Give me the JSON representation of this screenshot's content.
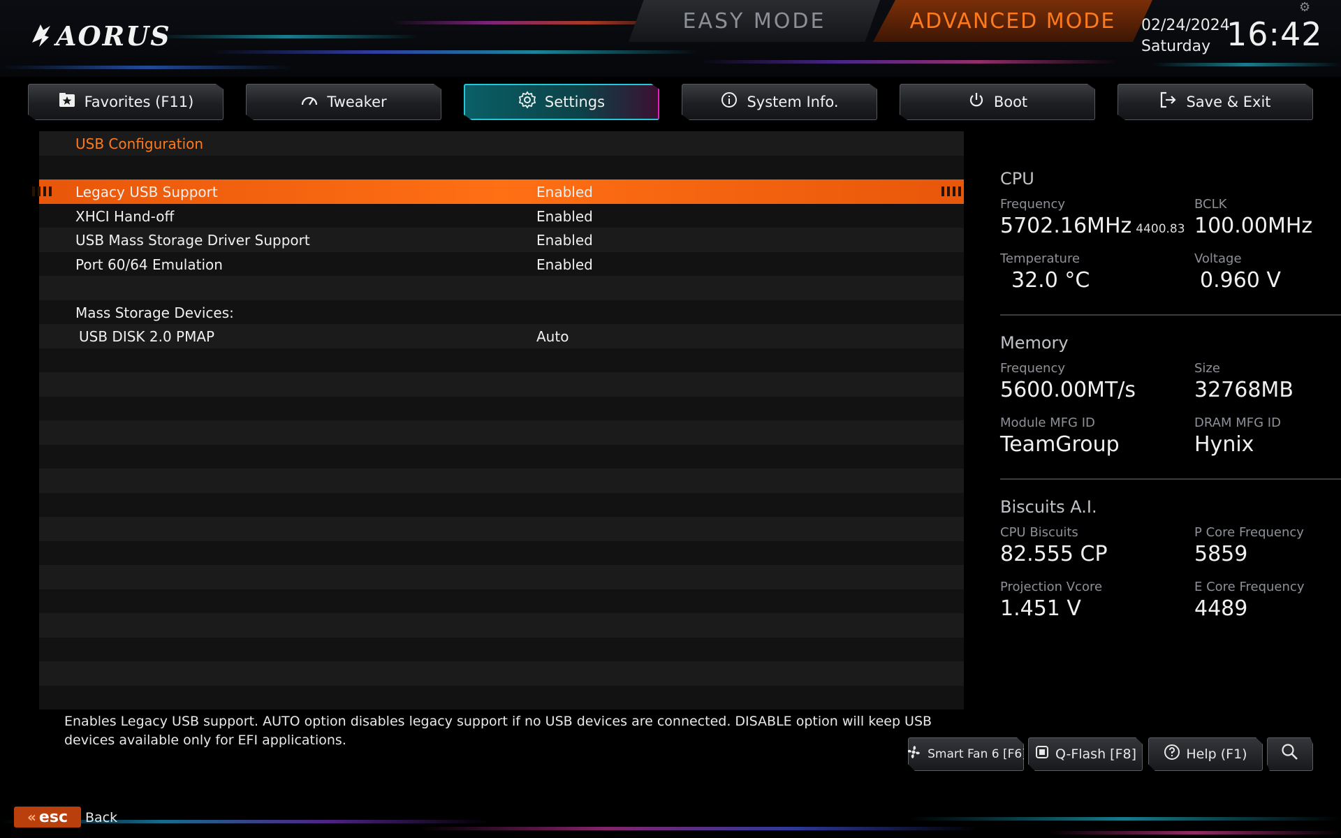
{
  "header": {
    "brand": "AORUS",
    "easy_mode": "EASY MODE",
    "advanced_mode": "ADVANCED MODE",
    "date": "02/24/2024",
    "day": "Saturday",
    "time": "16:42"
  },
  "tabs": [
    {
      "label": "Favorites (F11)",
      "icon": "star-folder-icon"
    },
    {
      "label": "Tweaker",
      "icon": "gauge-icon"
    },
    {
      "label": "Settings",
      "icon": "gear-icon",
      "active": true
    },
    {
      "label": "System Info.",
      "icon": "info-icon"
    },
    {
      "label": "Boot",
      "icon": "power-icon"
    },
    {
      "label": "Save & Exit",
      "icon": "exit-icon"
    }
  ],
  "settings": {
    "section_title": "USB Configuration",
    "rows": [
      {
        "label": "Legacy USB Support",
        "value": "Enabled"
      },
      {
        "label": "XHCI Hand-off",
        "value": "Enabled"
      },
      {
        "label": "USB Mass Storage Driver Support",
        "value": "Enabled"
      },
      {
        "label": "Port 60/64 Emulation",
        "value": "Enabled"
      }
    ],
    "mass_storage_title": "Mass Storage Devices:",
    "device": {
      "label": "USB DISK 2.0 PMAP",
      "value": "Auto"
    }
  },
  "info": {
    "cpu": {
      "title": "CPU",
      "frequency_label": "Frequency",
      "frequency_value": "5702.16MHz",
      "frequency_sub": "4400.83",
      "bclk_label": "BCLK",
      "bclk_value": "100.00MHz",
      "temperature_label": "Temperature",
      "temperature_value": "32.0 °C",
      "voltage_label": "Voltage",
      "voltage_value": "0.960 V"
    },
    "memory": {
      "title": "Memory",
      "frequency_label": "Frequency",
      "frequency_value": "5600.00MT/s",
      "size_label": "Size",
      "size_value": "32768MB",
      "module_label": "Module MFG ID",
      "module_value": "TeamGroup",
      "dram_label": "DRAM MFG ID",
      "dram_value": "Hynix"
    },
    "biscuits": {
      "title": "Biscuits A.I.",
      "cpu_biscuits_label": "CPU Biscuits",
      "cpu_biscuits_value": "82.555 CP",
      "pcore_label": "P Core Frequency",
      "pcore_value": "5859",
      "vcore_label": "Projection Vcore",
      "vcore_value": "1.451 V",
      "ecore_label": "E Core Frequency",
      "ecore_value": "4489"
    }
  },
  "description": "Enables Legacy USB support. AUTO option disables legacy support if no USB devices are connected. DISABLE option will keep USB devices available only for EFI applications.",
  "bottom_buttons": {
    "smart_fan": "Smart Fan 6 [F6]",
    "qflash": "Q-Flash [F8]",
    "help": "Help (F1)"
  },
  "footer": {
    "esc": "esc",
    "back": "Back"
  },
  "colors": {
    "accent_orange": "#ff7a1c",
    "selection_orange": "#ff6f14",
    "active_tab_cyan": "#25c6d6",
    "active_tab_magenta": "#e21ec0"
  }
}
